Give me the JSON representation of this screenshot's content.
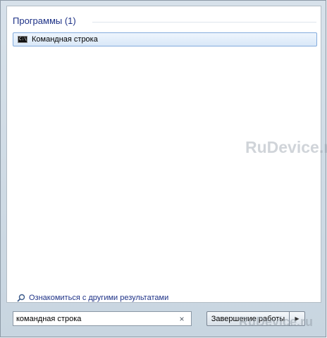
{
  "results": {
    "section_title": "Программы (1)",
    "items": [
      {
        "label": "Командная строка",
        "icon": "cmd-icon"
      }
    ],
    "more_results": "Ознакомиться с другими результатами"
  },
  "search": {
    "value": "командная строка",
    "clear_glyph": "×"
  },
  "shutdown": {
    "label": "Завершение работы",
    "arrow_glyph": "▶"
  },
  "watermark": "RuDevice.ru"
}
